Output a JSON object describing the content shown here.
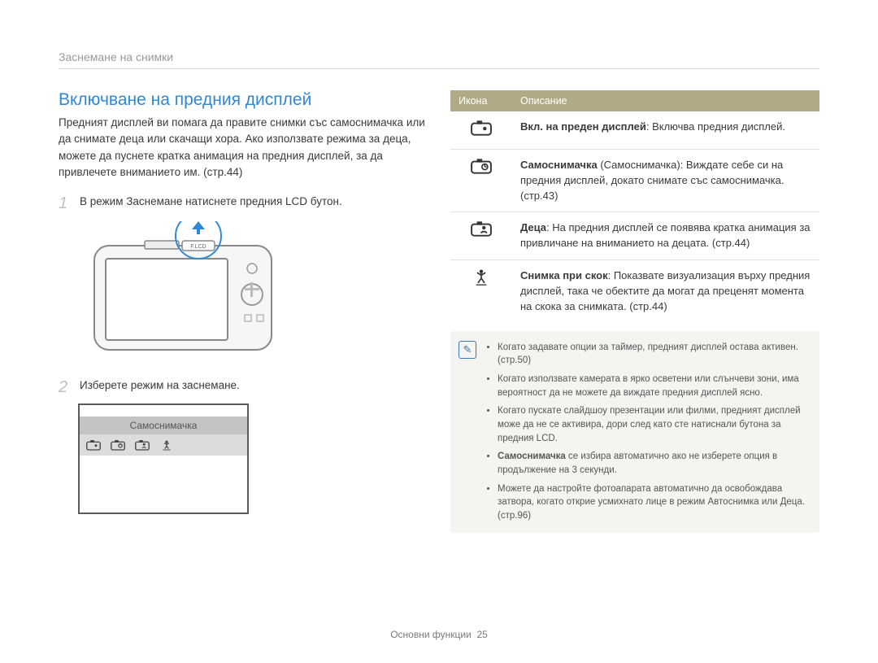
{
  "breadcrumb": "Заснемане на снимки",
  "title": "Включване на предния дисплей",
  "intro": "Предният дисплей ви помага да правите снимки със самоснимачка или да снимате деца или скачащи хора. Ако използвате режима за деца, можете да пуснете кратка анимация на предния дисплей, за да привлечете вниманието им. (стр.44)",
  "steps": {
    "one_num": "1",
    "one_text": "В режим Заснемане натиснете предния LCD бутон.",
    "two_num": "2",
    "two_text": "Изберете режим на заснемане."
  },
  "flcd_label": "F.LCD",
  "menu": {
    "header": "Самоснимачка"
  },
  "table": {
    "head_icon": "Икона",
    "head_desc": "Описание",
    "rows": [
      {
        "bold": "Вкл. на преден дисплей",
        "text": ": Включва предния дисплей."
      },
      {
        "bold": "Самоснимачка",
        "text": " (Самоснимачка): Виждате себе си на предния дисплей, докато снимате със самоснимачка. (стр.43)"
      },
      {
        "bold": "Деца",
        "text": ": На предния дисплей се появява кратка анимация за привличане на вниманието на децата. (стр.44)"
      },
      {
        "bold": "Снимка при скок",
        "text": ": Показвате визуализация върху предния дисплей, така че обектите да могат да преценят момента на скока за снимката. (стр.44)"
      }
    ]
  },
  "notes": [
    "Когато задавате опции за таймер, предният дисплей остава активен. (стр.50)",
    "Когато използвате камерата в ярко осветени или слънчеви зони, има вероятност да не можете да виждате предния дисплей ясно.",
    "Когато пускате слайдшоу презентации или филми, предният дисплей може да не се активира, дори след като сте натиснали бутона за предния LCD.",
    "Самоснимачка се избира автоматично ако не изберете опция в продължение на 3 секунди.",
    "Можете да настройте фотоапарата автоматично да освобождава затвора, когато открие усмихнато лице в режим Автоснимка или Деца. (стр.96)"
  ],
  "note_bold_word": "Самоснимачка",
  "footer": {
    "label": "Основни функции",
    "page": "25"
  }
}
